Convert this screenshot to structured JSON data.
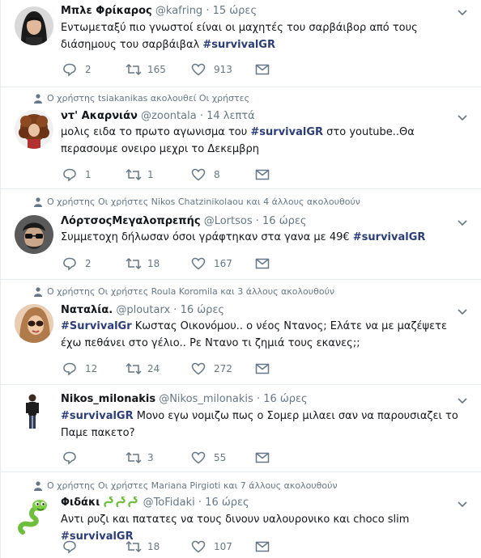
{
  "tweets": [
    {
      "context": "",
      "name": "Μπλε Φρίκαρος",
      "handle": "@kafring",
      "time": "15 ώρες",
      "text_before": "Εντωμεταξύ πιο γνωστοί είναι οι μαχητές του σαρβάιβορ από τους διάσημους του σαρβάιβαλ ",
      "hashtag": "#survivalGR",
      "text_after": "",
      "replies": "2",
      "retweets": "165",
      "likes": "913",
      "avatar_icon": "woman-portrait-avatar"
    },
    {
      "context": "Ο χρήστης tsiakanikas ακολουθεί Οι χρήστες",
      "name": "ντ' Ακαρνιάν",
      "handle": "@zoontala",
      "time": "14 λεπτά",
      "text_before": "μολις ειδα το πρωτο αγωνισμα του ",
      "hashtag": "#survivalGR",
      "text_after": " στο youtube..Θα περασουμε ονειρο μεχρι το Δεκεμβρη",
      "replies": "1",
      "retweets": "1",
      "likes": "8",
      "avatar_icon": "curly-hair-avatar"
    },
    {
      "context": "Ο χρήστης Οι χρήστες Nikos Chatzinikolaou και 4 άλλους ακολουθούν",
      "name": "ΛόρτσοςΜεγαλοπρεπής",
      "handle": "@Lortsos",
      "time": "16 ώρες",
      "text_before": "Συμμετοχη δήλωσαν όσοι γράφτηκαν στα γανα με 49€ ",
      "hashtag": "#survivalGR",
      "text_after": "",
      "replies": "2",
      "retweets": "18",
      "likes": "167",
      "avatar_icon": "sunglasses-avatar"
    },
    {
      "context": "Ο χρήστης Οι χρήστες Roula Koromila και 3 άλλους ακολουθούν",
      "name": "Ναταλία.",
      "handle": "@ploutarx",
      "time": "16 ώρες",
      "text_before": "",
      "hashtag": "#SurvivalGr",
      "text_after": " Κωστας Οικονόμου.. ο νέος Ντανος; Ελάτε να με μαζέψετε έχω πεθάνει στο γέλιο.. Ρε Ντανο τι ζημιά τους εκανες;;",
      "replies": "12",
      "retweets": "24",
      "likes": "272",
      "avatar_icon": "woman-sunglasses-avatar"
    },
    {
      "context": "",
      "name": "Nikos_milonakis",
      "handle": "@Nikos_milonakis",
      "time": "16 ώρες",
      "text_before": "",
      "hashtag": "#survivalGR",
      "text_after": " Μονο εγω νομιζω πως ο Σομερ μιλαει σαν να παρουσιαζει το Παμε πακετο?",
      "replies": "",
      "retweets": "3",
      "likes": "55",
      "avatar_icon": "standing-man-avatar"
    },
    {
      "context": "Ο χρήστης Οι χρήστες Mariana Pirgioti και 7 άλλους ακολουθούν",
      "name": "Φιδάκι",
      "handle": "@ToFidaki",
      "time": "16 ώρες",
      "text_before": "Αντι ρυζι και πατατες να τους δινουν υαλουρονικο και choco slim ",
      "hashtag": "#survivalGR",
      "text_after": "",
      "replies": "",
      "retweets": "18",
      "likes": "107",
      "avatar_icon": "cartoon-snake-avatar"
    }
  ],
  "colors": {
    "hashtag": "#2b3d7b",
    "muted": "#657786",
    "divider": "#e6ecf0",
    "snake_green": "#6cbf3b"
  }
}
